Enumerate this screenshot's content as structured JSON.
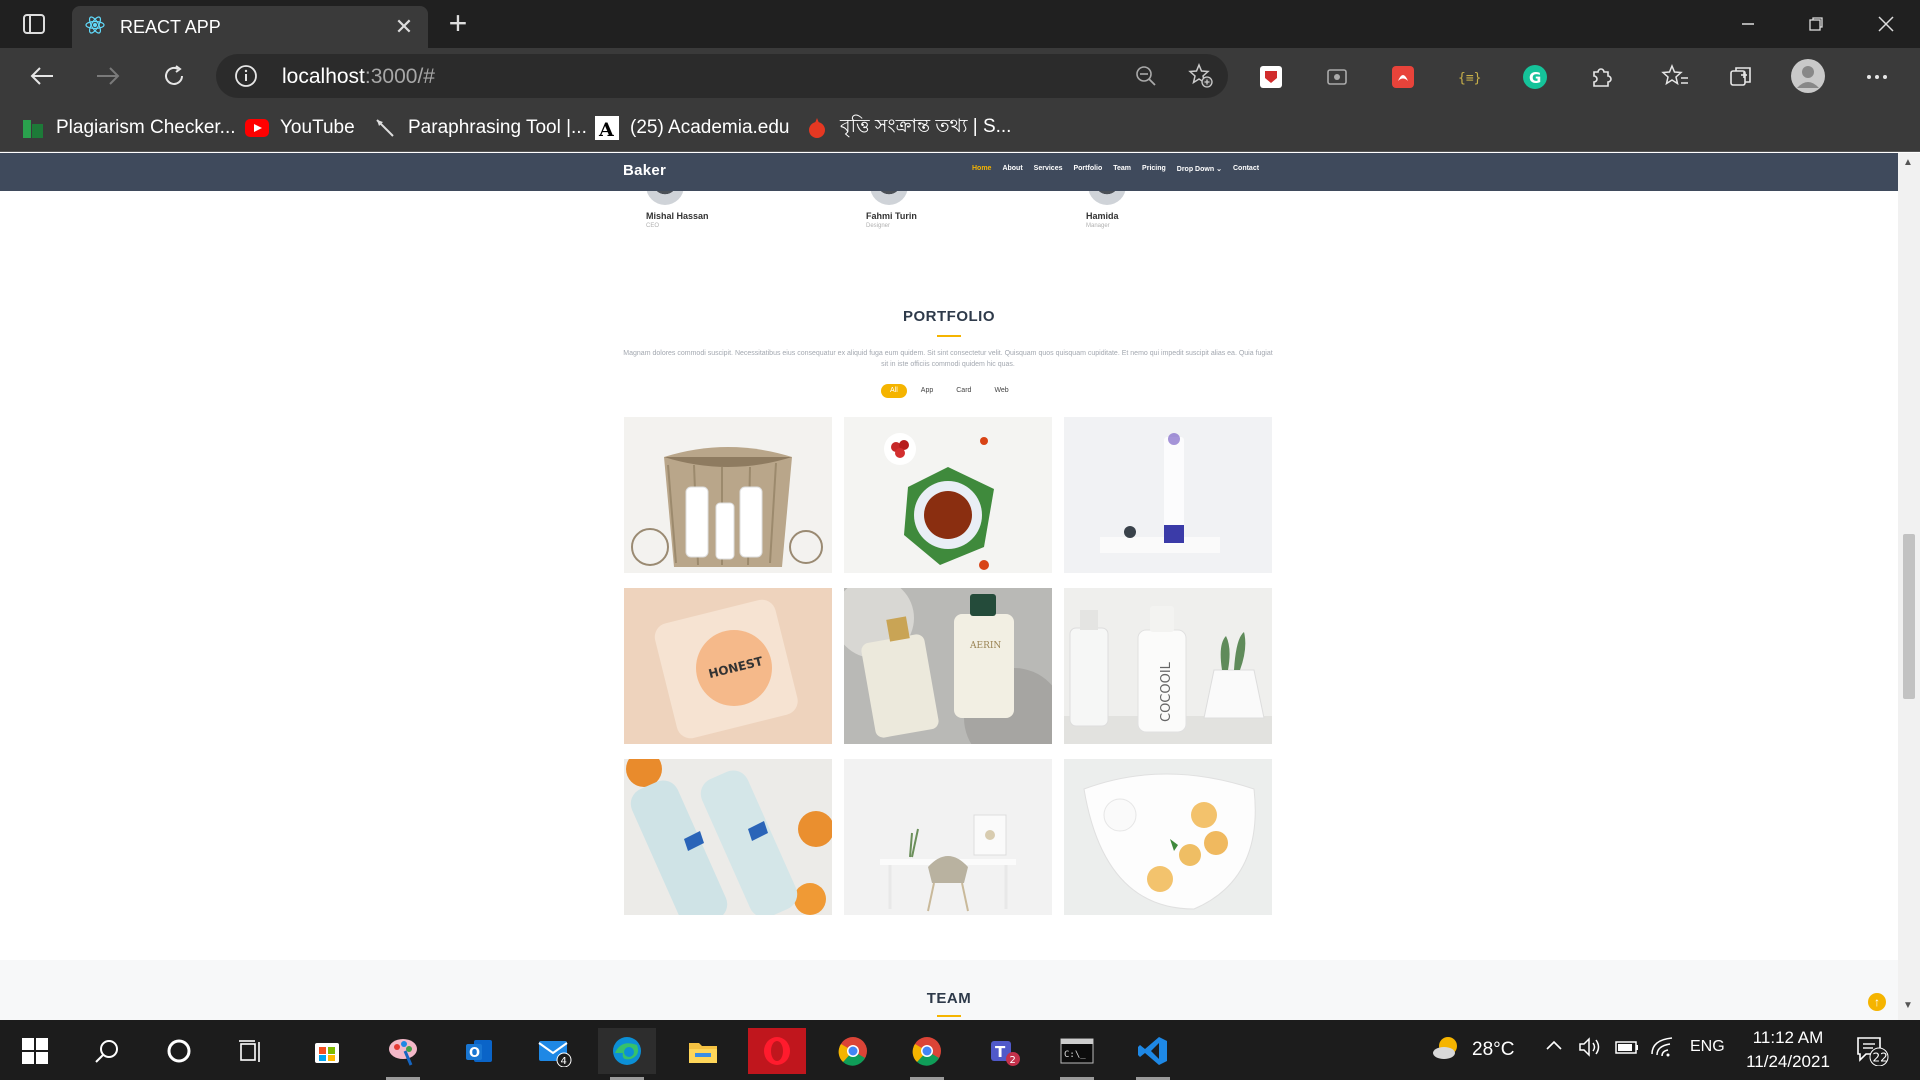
{
  "browser": {
    "tab_title": "REACT APP",
    "url_host": "localhost",
    "url_rest": ":3000/#",
    "bookmarks": [
      {
        "label": "Plagiarism Checker...",
        "icon": "plagiarism-checker-icon"
      },
      {
        "label": "YouTube",
        "icon": "youtube-icon"
      },
      {
        "label": "Paraphrasing Tool |...",
        "icon": "quill-icon"
      },
      {
        "label": "(25) Academia.edu",
        "icon": "academia-icon"
      },
      {
        "label": "বৃত্তি সংক্রান্ত তথ্য | S...",
        "icon": "bookmark-site-icon"
      }
    ]
  },
  "site": {
    "logo": "Baker",
    "nav": [
      "Home",
      "About",
      "Services",
      "Portfolio",
      "Team",
      "Pricing",
      "Drop Down",
      "Contact"
    ],
    "members": [
      {
        "name": "Mishal Hassan",
        "role": "CEO"
      },
      {
        "name": "Fahmi Turin",
        "role": "Designer"
      },
      {
        "name": "Hamida",
        "role": "Manager"
      }
    ],
    "portfolio": {
      "title": "PORTFOLIO",
      "description": "Magnam dolores commodi suscipit. Necessitatibus eius consequatur ex aliquid fuga eum quidem. Sit sint consectetur velit. Quisquam quos quisquam cupiditate. Et nemo qui impedit suscipit alias ea. Quia fugiat sit in iste officiis commodi quidem hic quas.",
      "filters": [
        "All",
        "App",
        "Card",
        "Web"
      ],
      "items": [
        {
          "subject": "basket with bottles"
        },
        {
          "subject": "tea cup with raspberries"
        },
        {
          "subject": "cream tube"
        },
        {
          "subject": "HONEST cosmetic compact",
          "label": "HONEST"
        },
        {
          "subject": "perfume bottles",
          "label": "AERIN"
        },
        {
          "subject": "COCOOIL bottle with plant",
          "label": "COCOOIL"
        },
        {
          "subject": "water bottles with oranges"
        },
        {
          "subject": "desk with chair"
        },
        {
          "subject": "plate with cookies"
        }
      ]
    },
    "team_title": "TEAM"
  },
  "taskbar": {
    "temperature": "28°C",
    "language": "ENG",
    "time": "11:12 AM",
    "date": "11/24/2021",
    "mail_badge": "4",
    "teams_badge": "2",
    "notifications": "22"
  },
  "colors": {
    "accent": "#f5b400",
    "header_bg": "#3f4a5c"
  }
}
